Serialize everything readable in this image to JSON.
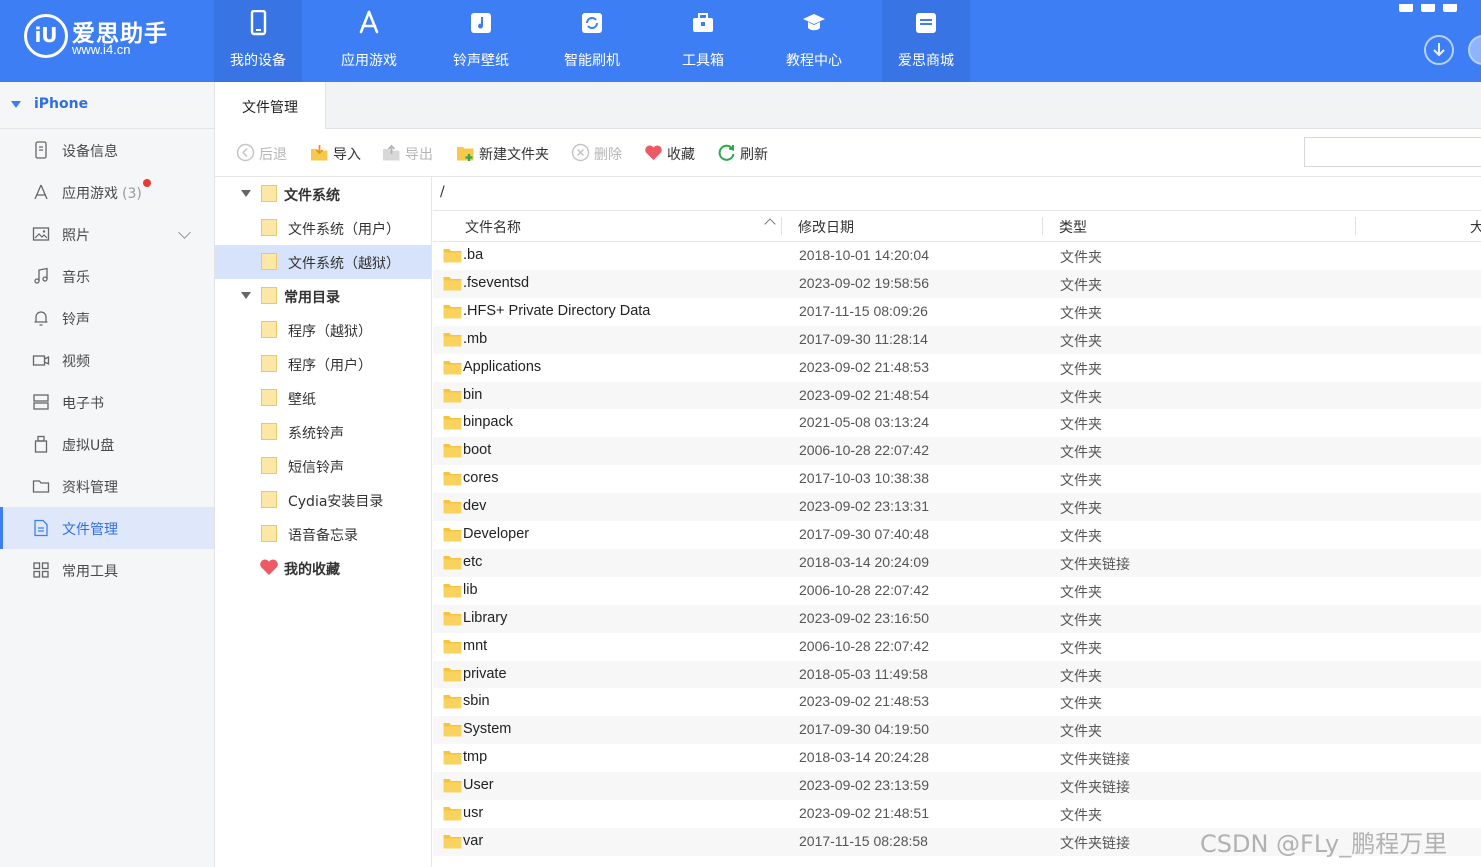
{
  "app": {
    "logo_badge": "iU",
    "logo_name": "爱思助手",
    "logo_url": "www.i4.cn",
    "accent_color": "#3d7ef5"
  },
  "nav_tabs": [
    {
      "label": "我的设备",
      "icon": "phone-icon",
      "active": true
    },
    {
      "label": "应用游戏",
      "icon": "app-store-icon"
    },
    {
      "label": "铃声壁纸",
      "icon": "music-icon"
    },
    {
      "label": "智能刷机",
      "icon": "flash-icon"
    },
    {
      "label": "工具箱",
      "icon": "toolbox-icon"
    },
    {
      "label": "教程中心",
      "icon": "graduation-cap-icon"
    },
    {
      "label": "爱思商城",
      "icon": "store-icon",
      "active": true
    }
  ],
  "sidebar": {
    "device_name": "iPhone",
    "items": [
      {
        "label": "设备信息",
        "icon": "device-info-icon"
      },
      {
        "label": "应用游戏",
        "count": "(3)",
        "icon": "app-store-icon",
        "badge": "red-dot"
      },
      {
        "label": "照片",
        "icon": "photo-icon",
        "expandable": true
      },
      {
        "label": "音乐",
        "icon": "music-note-icon"
      },
      {
        "label": "铃声",
        "icon": "bell-icon"
      },
      {
        "label": "视频",
        "icon": "video-icon"
      },
      {
        "label": "电子书",
        "icon": "ebook-icon"
      },
      {
        "label": "虚拟U盘",
        "icon": "usb-drive-icon"
      },
      {
        "label": "资料管理",
        "icon": "folder-icon"
      },
      {
        "label": "文件管理",
        "icon": "file-icon",
        "active": true
      },
      {
        "label": "常用工具",
        "icon": "grid-icon"
      }
    ]
  },
  "tab": {
    "label": "文件管理"
  },
  "toolbar": {
    "back": "后退",
    "import": "导入",
    "export": "导出",
    "new_folder": "新建文件夹",
    "delete": "删除",
    "favorite": "收藏",
    "refresh": "刷新"
  },
  "tree": [
    {
      "label": "文件系统",
      "level": 0,
      "expanded": true,
      "bold": true
    },
    {
      "label": "文件系统（用户）",
      "level": 1
    },
    {
      "label": "文件系统（越狱）",
      "level": 1,
      "selected": true
    },
    {
      "label": "常用目录",
      "level": 0,
      "expanded": true,
      "bold": true
    },
    {
      "label": "程序（越狱）",
      "level": 1
    },
    {
      "label": "程序（用户）",
      "level": 1
    },
    {
      "label": "壁纸",
      "level": 1
    },
    {
      "label": "系统铃声",
      "level": 1
    },
    {
      "label": "短信铃声",
      "level": 1
    },
    {
      "label": "Cydia安装目录",
      "level": 1
    },
    {
      "label": "语音备忘录",
      "level": 1
    },
    {
      "label": "我的收藏",
      "level": 0,
      "bold": true,
      "icon": "heart-icon"
    }
  ],
  "path": "/",
  "columns": {
    "name": "文件名称",
    "date": "修改日期",
    "type": "类型",
    "size": "大"
  },
  "files": [
    {
      "name": ".ba",
      "date": "2018-10-01 14:20:04",
      "type": "文件夹"
    },
    {
      "name": ".fseventsd",
      "date": "2023-09-02 19:58:56",
      "type": "文件夹"
    },
    {
      "name": ".HFS+ Private Directory Data",
      "date": "2017-11-15 08:09:26",
      "type": "文件夹"
    },
    {
      "name": ".mb",
      "date": "2017-09-30 11:28:14",
      "type": "文件夹"
    },
    {
      "name": "Applications",
      "date": "2023-09-02 21:48:53",
      "type": "文件夹"
    },
    {
      "name": "bin",
      "date": "2023-09-02 21:48:54",
      "type": "文件夹"
    },
    {
      "name": "binpack",
      "date": "2021-05-08 03:13:24",
      "type": "文件夹"
    },
    {
      "name": "boot",
      "date": "2006-10-28 22:07:42",
      "type": "文件夹"
    },
    {
      "name": "cores",
      "date": "2017-10-03 10:38:38",
      "type": "文件夹"
    },
    {
      "name": "dev",
      "date": "2023-09-02 23:13:31",
      "type": "文件夹"
    },
    {
      "name": "Developer",
      "date": "2017-09-30 07:40:48",
      "type": "文件夹"
    },
    {
      "name": "etc",
      "date": "2018-03-14 20:24:09",
      "type": "文件夹链接"
    },
    {
      "name": "lib",
      "date": "2006-10-28 22:07:42",
      "type": "文件夹"
    },
    {
      "name": "Library",
      "date": "2023-09-02 23:16:50",
      "type": "文件夹"
    },
    {
      "name": "mnt",
      "date": "2006-10-28 22:07:42",
      "type": "文件夹"
    },
    {
      "name": "private",
      "date": "2018-05-03 11:49:58",
      "type": "文件夹"
    },
    {
      "name": "sbin",
      "date": "2023-09-02 21:48:53",
      "type": "文件夹"
    },
    {
      "name": "System",
      "date": "2017-09-30 04:19:50",
      "type": "文件夹"
    },
    {
      "name": "tmp",
      "date": "2018-03-14 20:24:28",
      "type": "文件夹链接"
    },
    {
      "name": "User",
      "date": "2023-09-02 23:13:59",
      "type": "文件夹链接"
    },
    {
      "name": "usr",
      "date": "2023-09-02 21:48:51",
      "type": "文件夹"
    },
    {
      "name": "var",
      "date": "2017-11-15 08:28:58",
      "type": "文件夹链接"
    }
  ],
  "watermark": "CSDN @FLy_鹏程万里"
}
